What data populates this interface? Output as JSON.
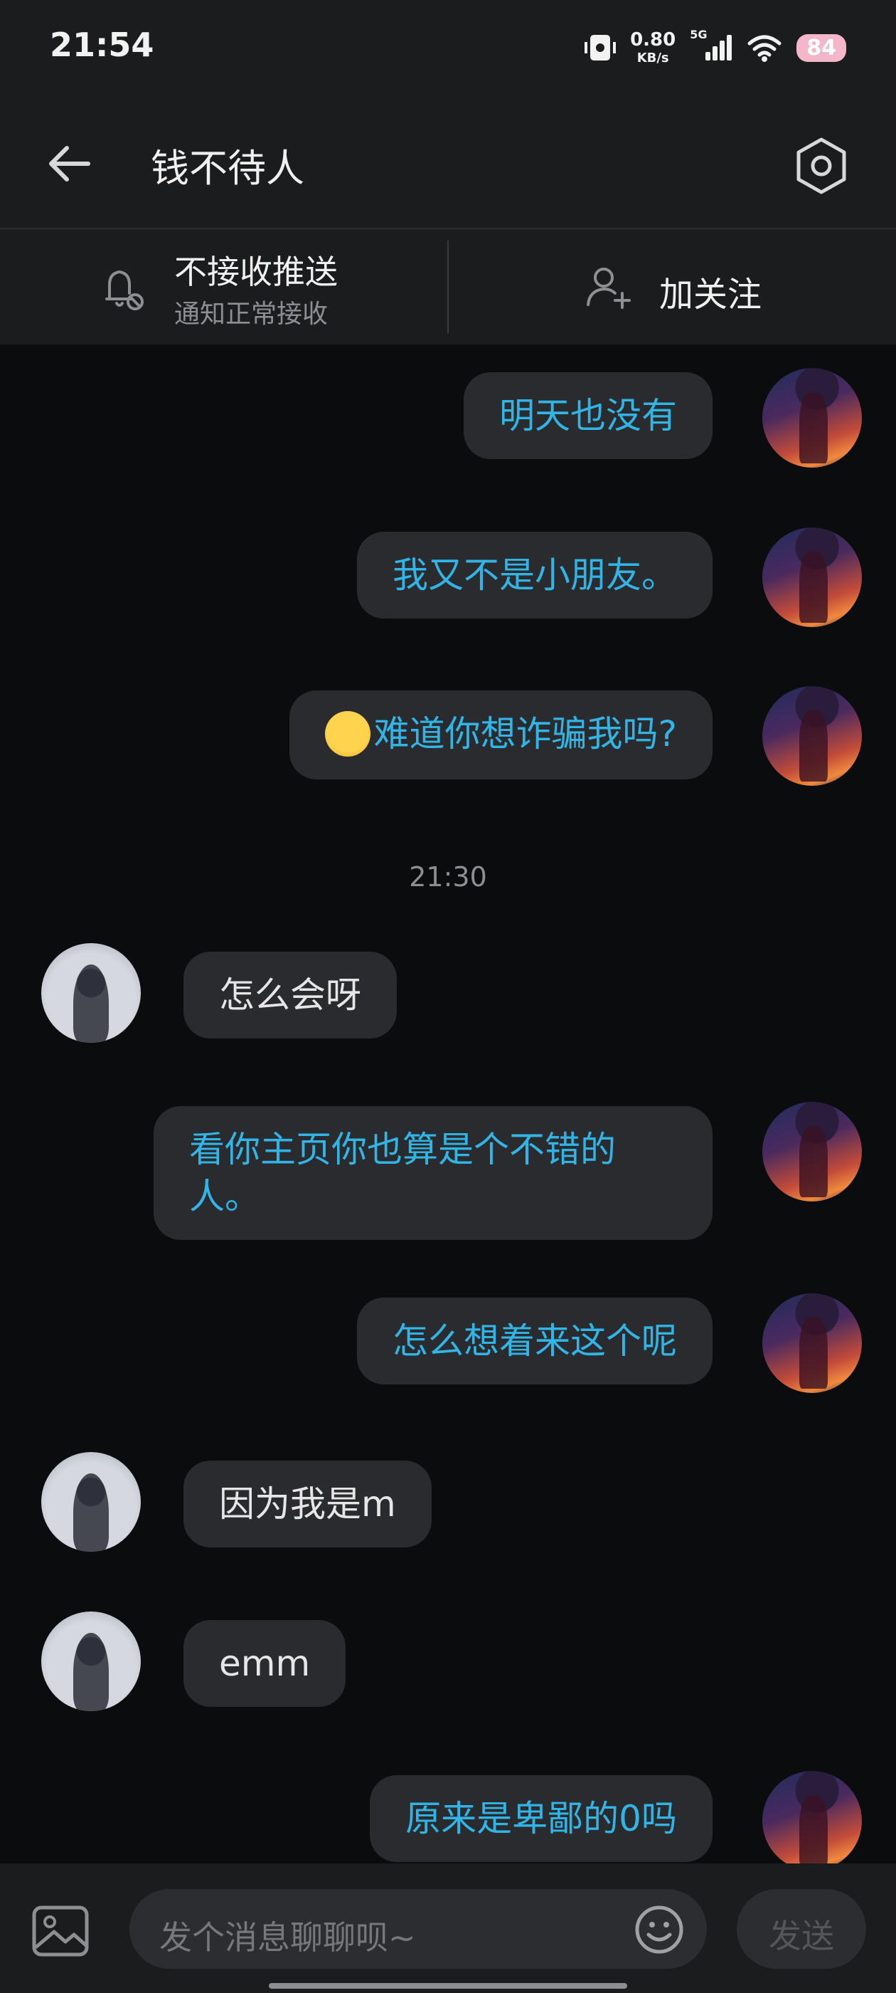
{
  "status_bar": {
    "time": "21:54",
    "net_speed": "0.80",
    "net_unit": "KB/s",
    "network": "5G",
    "battery": "84"
  },
  "header": {
    "title": "钱不待人"
  },
  "subbar": {
    "push_title": "不接收推送",
    "push_sub": "通知正常接收",
    "follow": "加关注"
  },
  "messages": [
    {
      "from": "me",
      "text": "明天也没有"
    },
    {
      "from": "me",
      "text": "我又不是小朋友。"
    },
    {
      "from": "me",
      "text": "难道你想诈骗我吗?",
      "emoji": "smug-face"
    },
    {
      "type": "timestamp",
      "text": "21:30"
    },
    {
      "from": "other",
      "text": "怎么会呀"
    },
    {
      "from": "me",
      "text": "看你主页你也算是个不错的人。"
    },
    {
      "from": "me",
      "text": "怎么想着来这个呢"
    },
    {
      "from": "other",
      "text": "因为我是m"
    },
    {
      "from": "other",
      "text": "emm"
    },
    {
      "from": "me",
      "text": "原来是卑鄙的0吗"
    }
  ],
  "input": {
    "placeholder": "发个消息聊聊呗~",
    "send": "发送"
  },
  "colors": {
    "my_text": "#31b5e6",
    "bubble": "#2a2b2e",
    "background": "#0b0c0e",
    "bar": "#1b1c1e"
  }
}
